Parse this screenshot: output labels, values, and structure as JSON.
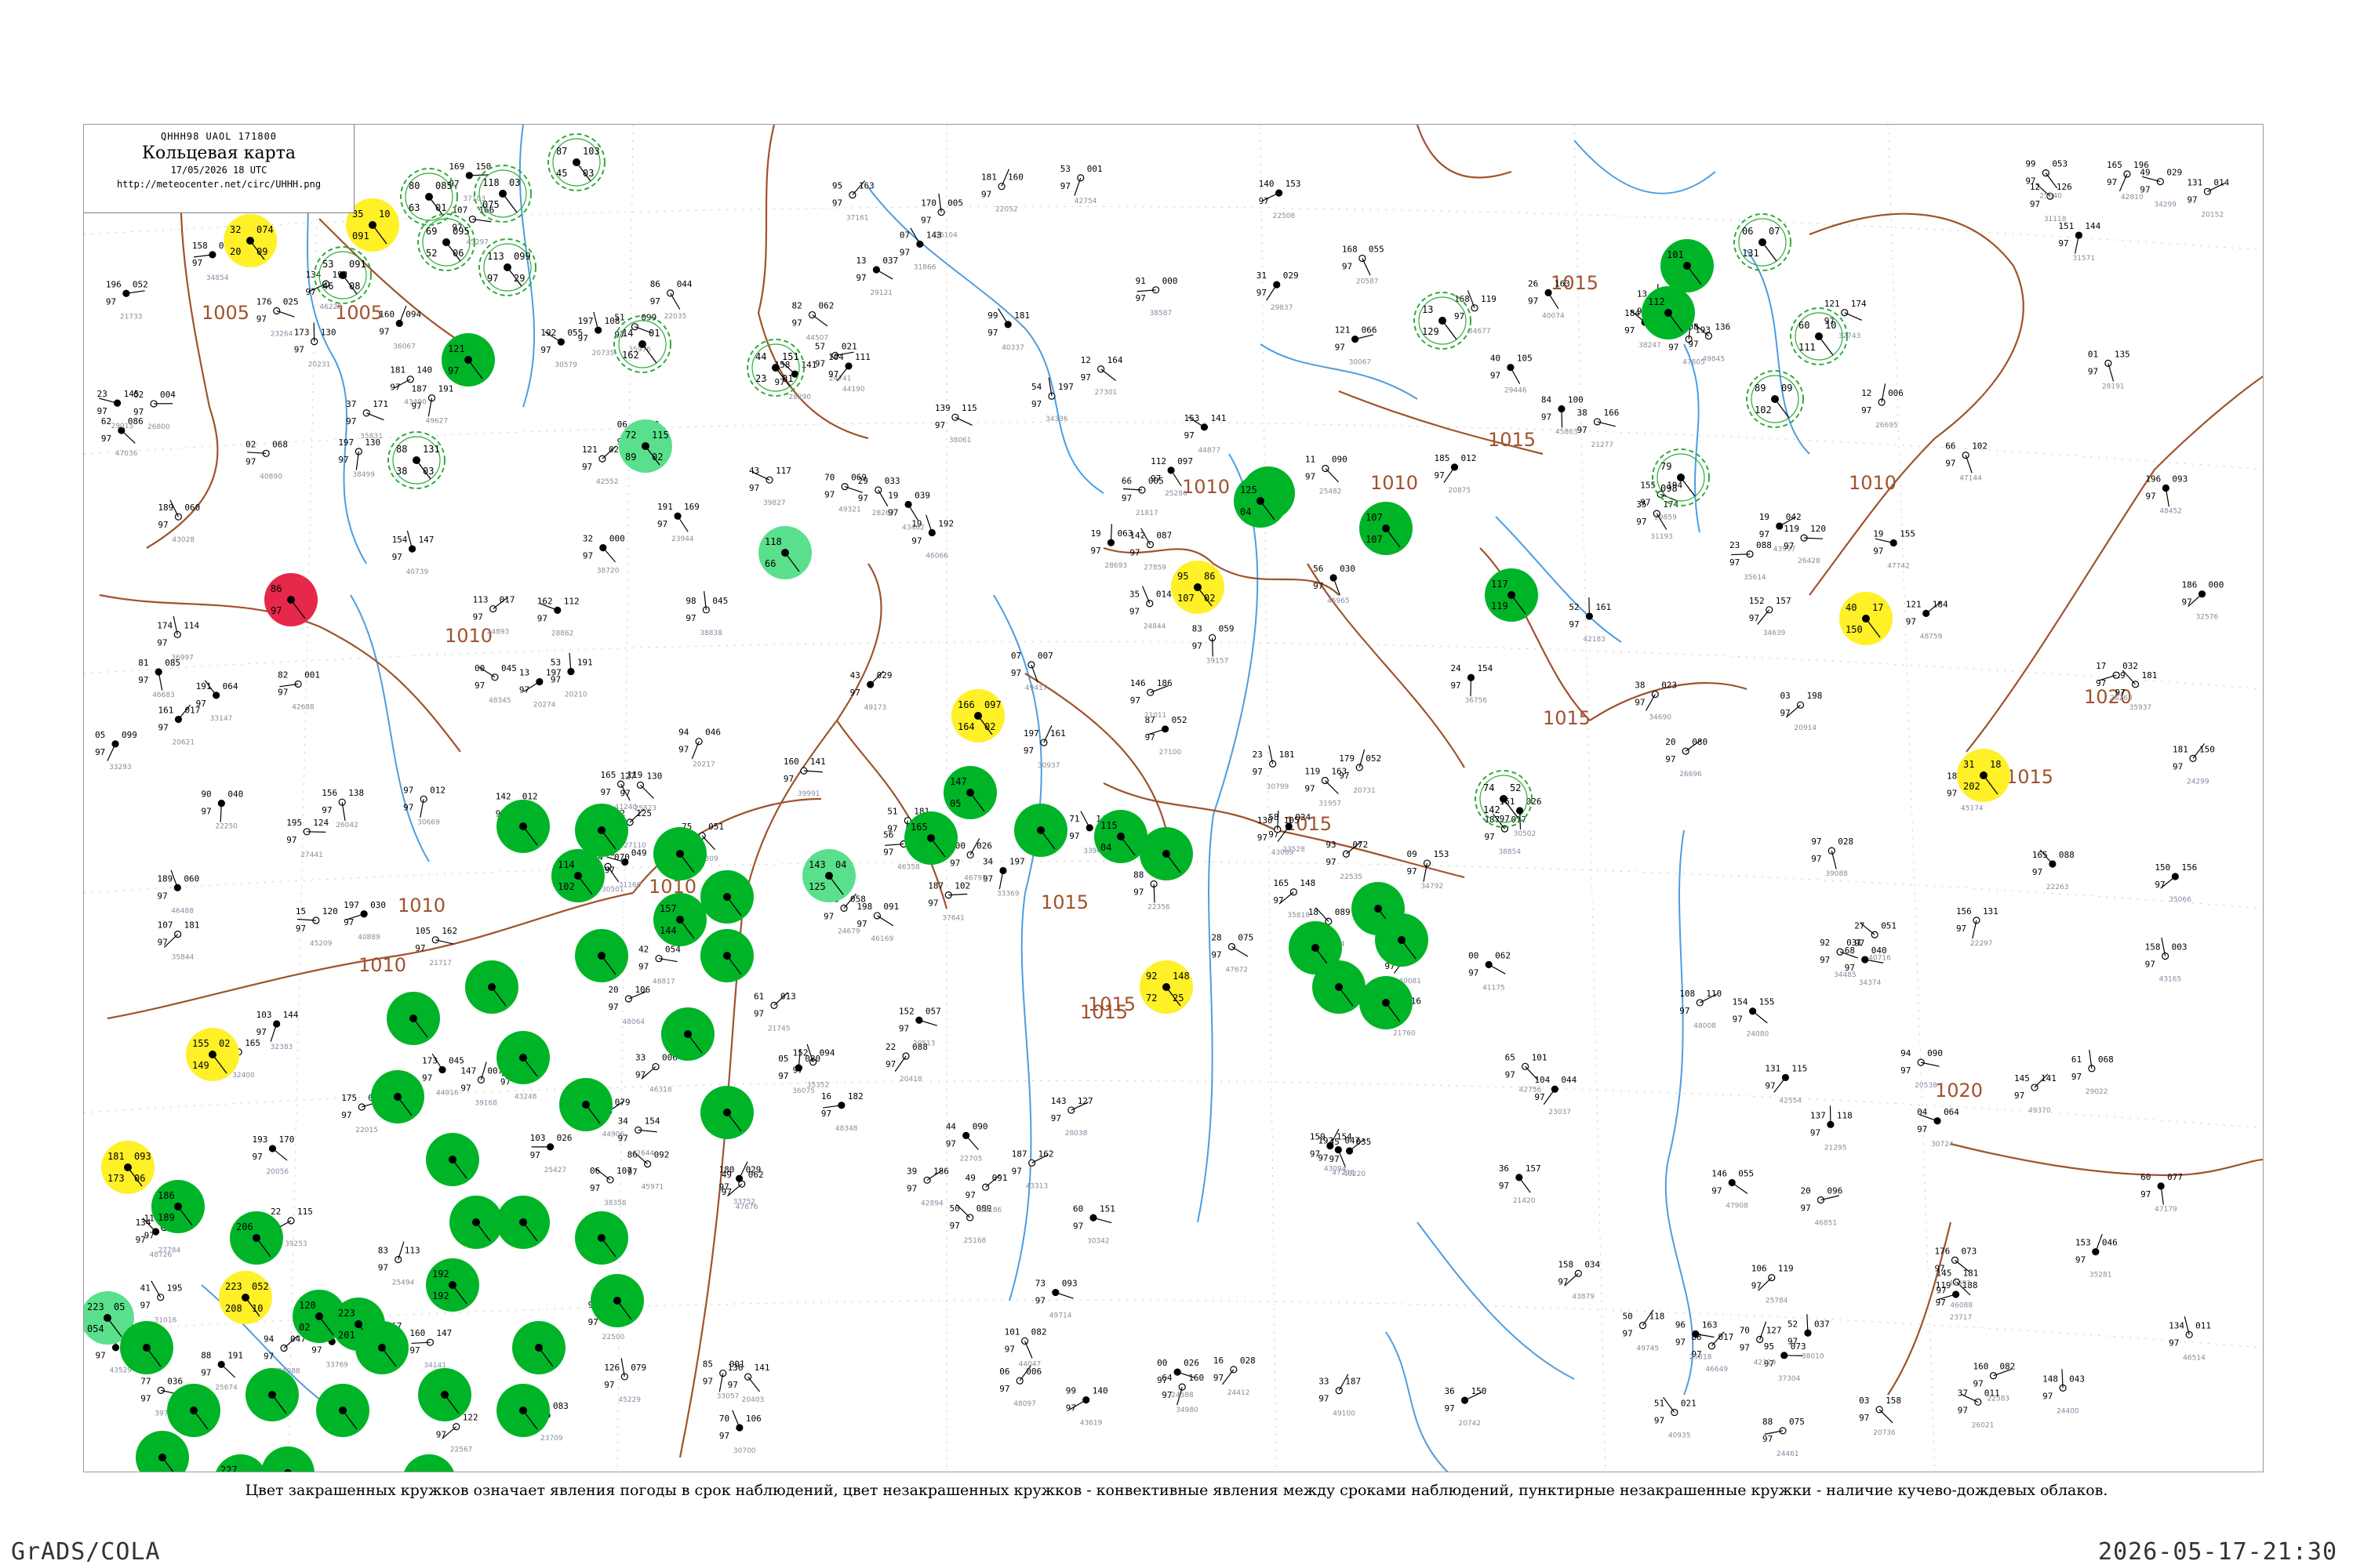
{
  "header": {
    "code": "QHHH98  UAOL  171800",
    "title": "Кольцевая карта",
    "date": "17/05/2026 18 UTC",
    "url": "http://meteocenter.net/circ/UHHH.png"
  },
  "caption": "Цвет закрашенных кружков означает явления погоды в срок наблюдений, цвет незакрашенных кружков - конвективные явления между сроками наблюдений, пунктирные незакрашенные кружки - наличие кучево-дождевых облаков.",
  "footer": {
    "left": "GrADS/COLA",
    "right": "2026-05-17-21:30"
  },
  "colors": {
    "green": "#00b428",
    "light_green": "#5ae08c",
    "yellow": "#fff028",
    "red": "#e6284a",
    "isobar": "#a0522d",
    "river": "#4d9de0",
    "dashed_ring": "#2eaa3a"
  },
  "isobar_labels": [
    "1005",
    "1005",
    "1010",
    "1010",
    "1010",
    "1010",
    "1010",
    "1010",
    "1010",
    "1015",
    "1015",
    "1015",
    "1015",
    "1015",
    "1015",
    "1015",
    "1015",
    "1020",
    "1020",
    "1015"
  ],
  "stations": [
    {
      "c": "yellow",
      "t": [
        "32",
        "20",
        "074",
        "09"
      ]
    },
    {
      "c": "yellow",
      "t": [
        "35",
        "091",
        "10"
      ]
    },
    {
      "c": "none",
      "t": [
        "53",
        "46",
        "091",
        "08"
      ]
    },
    {
      "c": "none",
      "t": [
        "80",
        "63",
        "085",
        "01"
      ]
    },
    {
      "c": "none",
      "t": [
        "69",
        "52",
        "095",
        "06"
      ]
    },
    {
      "c": "none",
      "t": [
        "118",
        "075",
        "03"
      ]
    },
    {
      "c": "none",
      "t": [
        "113",
        "97",
        "099",
        "29"
      ]
    },
    {
      "c": "green",
      "t": [
        "121",
        "97"
      ]
    },
    {
      "c": "none",
      "t": [
        "87",
        "45",
        "103",
        "03"
      ]
    },
    {
      "c": "none",
      "t": [
        "14",
        "162",
        "01"
      ]
    },
    {
      "c": "none",
      "t": [
        "44",
        "23",
        "151",
        "01"
      ]
    },
    {
      "c": "light_green",
      "t": [
        "72",
        "89",
        "115",
        "02"
      ]
    },
    {
      "c": "none",
      "t": [
        "88",
        "38",
        "131",
        "03"
      ]
    },
    {
      "c": "light_green",
      "t": [
        "118",
        "66"
      ]
    },
    {
      "c": "red",
      "t": [
        "86",
        "97"
      ]
    },
    {
      "c": "yellow",
      "t": [
        "166",
        "164",
        "097",
        "02"
      ]
    },
    {
      "c": "green",
      "t": [
        "147",
        "05"
      ]
    },
    {
      "c": "green",
      "t": [
        "165"
      ]
    },
    {
      "c": "light_green",
      "t": [
        "143",
        "125",
        "04"
      ]
    },
    {
      "c": "green",
      "t": [
        "115",
        "04"
      ]
    },
    {
      "c": "green",
      "t": [
        "114",
        "102"
      ]
    },
    {
      "c": "green",
      "t": [
        "157",
        "144"
      ]
    },
    {
      "c": "yellow",
      "t": [
        "155",
        "149",
        "02"
      ]
    },
    {
      "c": "yellow",
      "t": [
        "181",
        "173",
        "093",
        "06"
      ]
    },
    {
      "c": "yellow",
      "t": [
        "223",
        "208",
        "052",
        "10"
      ]
    },
    {
      "c": "light_green",
      "t": [
        "223",
        "054",
        "05"
      ]
    },
    {
      "c": "green",
      "t": [
        "120",
        "02"
      ]
    },
    {
      "c": "green",
      "t": [
        "186",
        "189"
      ]
    },
    {
      "c": "green",
      "t": [
        "206"
      ]
    },
    {
      "c": "green",
      "t": [
        "192",
        "192"
      ]
    },
    {
      "c": "green",
      "t": [
        "223",
        "201"
      ]
    },
    {
      "c": "green",
      "t": [
        "227",
        "229"
      ]
    },
    {
      "c": "yellow",
      "t": [
        "92",
        "72",
        "148",
        "25"
      ]
    },
    {
      "c": "green",
      "t": [
        "129",
        "01"
      ]
    },
    {
      "c": "green",
      "t": [
        "125",
        "04"
      ]
    },
    {
      "c": "green",
      "t": [
        "117",
        "119"
      ]
    },
    {
      "c": "green",
      "t": [
        "107",
        "107"
      ]
    },
    {
      "c": "green",
      "t": [
        "101"
      ]
    },
    {
      "c": "green",
      "t": [
        "112"
      ]
    },
    {
      "c": "yellow",
      "t": [
        "95",
        "107",
        "86",
        "02"
      ]
    },
    {
      "c": "yellow",
      "t": [
        "40",
        "150",
        "17"
      ]
    },
    {
      "c": "yellow",
      "t": [
        "31",
        "202",
        "18"
      ]
    },
    {
      "c": "none",
      "t": [
        "06",
        "131",
        "07"
      ]
    },
    {
      "c": "none",
      "t": [
        "60",
        "111",
        "10"
      ]
    },
    {
      "c": "none",
      "t": [
        "89",
        "102",
        "09"
      ]
    },
    {
      "c": "none",
      "t": [
        "79",
        "098"
      ]
    },
    {
      "c": "none",
      "t": [
        "13",
        "129"
      ]
    },
    {
      "c": "none",
      "t": [
        "74",
        "142",
        "52"
      ]
    }
  ]
}
